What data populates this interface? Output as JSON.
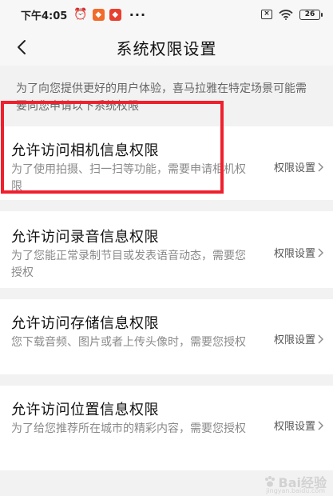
{
  "status_bar": {
    "time": "下午4:05",
    "battery": "26"
  },
  "nav": {
    "title": "系统权限设置"
  },
  "intro_text": "为了向您提供更好的用户体验，喜马拉雅在特定场景可能需要向您申请以下系统权限",
  "permissions": [
    {
      "title": "允许访问相机信息权限",
      "desc": "为了使用拍摄、扫一扫等功能，需要申请相机权限",
      "link": "权限设置"
    },
    {
      "title": "允许访问录音信息权限",
      "desc": "为了您能正常录制节目或发表语音动态，需要您授权",
      "link": "权限设置"
    },
    {
      "title": "允许访问存储信息权限",
      "desc": "您下载音频、图片或者上传头像时，需要您授权",
      "link": "权限设置"
    },
    {
      "title": "允许访问位置信息权限",
      "desc": "为了给您推荐所在城市的精彩内容，需要您授权",
      "link": "权限设置"
    }
  ],
  "watermark": {
    "text": "Bai经验",
    "sub": "jingyan.baidu.com"
  }
}
